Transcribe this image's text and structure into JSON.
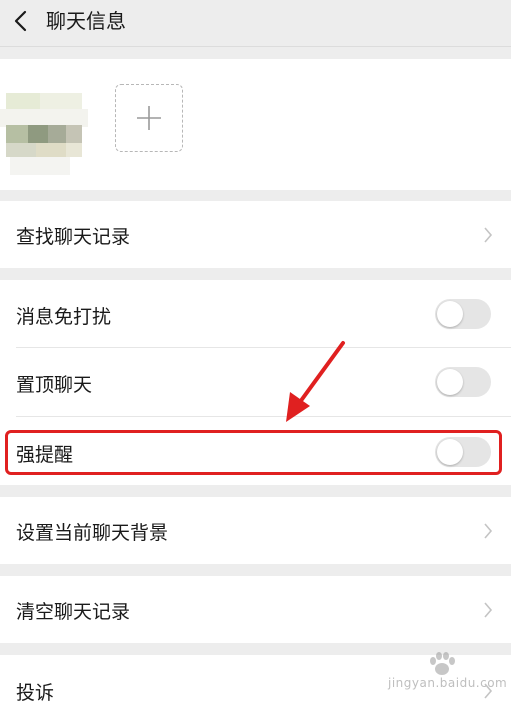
{
  "header": {
    "title": "聊天信息",
    "back_icon": "back-chevron-icon"
  },
  "members": {
    "avatar_icon": "blurred-avatar",
    "add_icon": "plus-icon"
  },
  "search_history": {
    "label": "查找聊天记录"
  },
  "settings": {
    "mute": {
      "label": "消息免打扰",
      "on": false
    },
    "pin": {
      "label": "置顶聊天",
      "on": false
    },
    "strong_reminder": {
      "label": "强提醒",
      "on": false
    }
  },
  "chat_background": {
    "label": "设置当前聊天背景"
  },
  "clear_history": {
    "label": "清空聊天记录"
  },
  "complain": {
    "label": "投诉"
  },
  "annotation": {
    "color": "#e02020"
  },
  "watermark": {
    "text": "jingyan.baidu.com"
  }
}
